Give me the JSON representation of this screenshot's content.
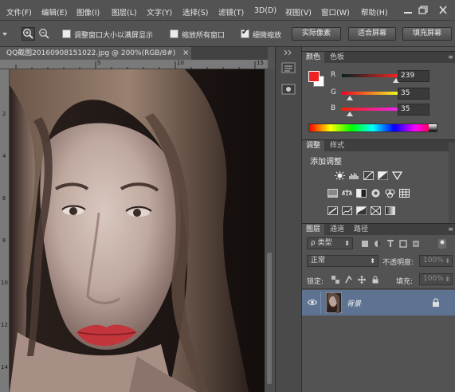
{
  "menu": [
    "文件(F)",
    "编辑(E)",
    "图像(I)",
    "图层(L)",
    "文字(Y)",
    "选择(S)",
    "滤镜(T)",
    "3D(D)",
    "视图(V)",
    "窗口(W)",
    "帮助(H)"
  ],
  "options": {
    "resize_windows": "调整窗口大小以满屏显示",
    "zoom_all_windows": "缩放所有窗口",
    "scrubby_zoom": "细微缩放",
    "actual_pixels": "实际像素",
    "fit_screen": "适合屏幕",
    "fill_screen": "填充屏幕"
  },
  "document": {
    "tab_title": "QQ截图20160908151022.jpg @ 200%(RGB/8#)",
    "ruler_h": [
      "5",
      "10",
      "15"
    ],
    "ruler_v": [
      "2",
      "4",
      "6",
      "8",
      "10",
      "12",
      "14"
    ]
  },
  "color_panel": {
    "tabs": [
      "颜色",
      "色板"
    ],
    "r_label": "R",
    "g_label": "G",
    "b_label": "B",
    "r": "239",
    "g": "35",
    "b": "35",
    "fg_color": "#ef2323",
    "bg_color": "#ffffff",
    "r_value": 239,
    "g_value": 35,
    "b_value": 35
  },
  "adjust_panel": {
    "tabs": [
      "调整",
      "样式"
    ],
    "title": "添加调整"
  },
  "layers_panel": {
    "tabs": [
      "图层",
      "通道",
      "路径"
    ],
    "filter_label": "ρ 类型",
    "blend_mode": "正常",
    "opacity_label": "不透明度:",
    "opacity_value": "100%",
    "lock_label": "锁定:",
    "fill_label": "填充:",
    "fill_value": "100%",
    "layer_name": "背景"
  }
}
